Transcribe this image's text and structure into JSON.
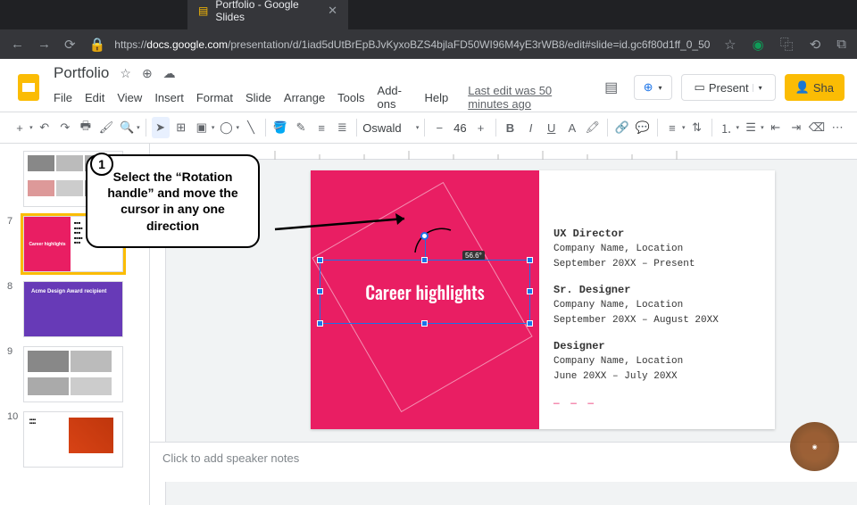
{
  "browser": {
    "tab_title": "Portfolio - Google Slides",
    "url_prefix": "https://",
    "url_domain": "docs.google.com",
    "url_path": "/presentation/d/1iad5dUtBrEpBJvKyxoBZS4bjlaFD50WI96M4yE3rWB8/edit#slide=id.gc6f80d1ff_0_50"
  },
  "header": {
    "title": "Portfolio",
    "menus": [
      "File",
      "Edit",
      "View",
      "Insert",
      "Format",
      "Slide",
      "Arrange",
      "Tools",
      "Add-ons",
      "Help"
    ],
    "last_edit": "Last edit was 50 minutes ago",
    "present": "Present",
    "share": "Sha"
  },
  "toolbar": {
    "font": "Oswald",
    "size": "46",
    "bold": "B",
    "italic": "I",
    "underline": "U"
  },
  "thumbnails": {
    "visible_numbers": [
      "7",
      "8",
      "9",
      "10"
    ],
    "t7_title": "Career highlights",
    "t8_title": "Acme Design Award recipient"
  },
  "slide": {
    "heading": "Career highlights",
    "angle": "56.6°",
    "jobs": [
      {
        "title": "UX Director",
        "company": "Company Name, Location",
        "dates": "September 20XX – Present"
      },
      {
        "title": "Sr. Designer",
        "company": "Company Name, Location",
        "dates": "September 20XX – August 20XX"
      },
      {
        "title": "Designer",
        "company": "Company Name, Location",
        "dates": "June 20XX – July 20XX"
      }
    ],
    "dashes": "— — —"
  },
  "notes": {
    "placeholder": "Click to add speaker notes"
  },
  "annotation": {
    "number": "1",
    "text": "Select the “Rotation handle” and move the cursor in any one direction"
  }
}
